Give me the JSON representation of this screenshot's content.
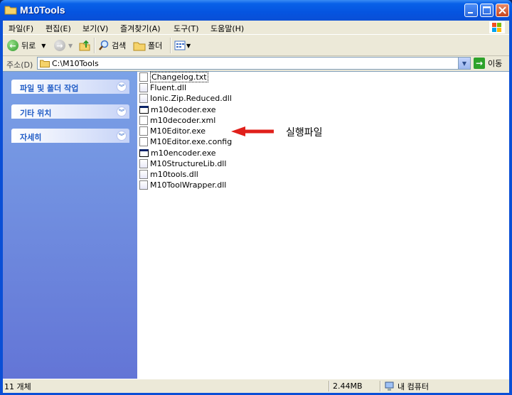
{
  "window": {
    "title": "M10Tools"
  },
  "menu": [
    "파일(F)",
    "편집(E)",
    "보기(V)",
    "즐겨찾기(A)",
    "도구(T)",
    "도움말(H)"
  ],
  "toolbar": {
    "back": "뒤로",
    "search": "검색",
    "folders": "폴더"
  },
  "address": {
    "label": "주소(D)",
    "path": "C:\\M10Tools",
    "go": "이동"
  },
  "taskpane": {
    "sections": [
      "파일 및 폴더 작업",
      "기타 위치",
      "자세히"
    ]
  },
  "files": [
    {
      "name": "Changelog.txt",
      "type": "txt"
    },
    {
      "name": "Fluent.dll",
      "type": "dll"
    },
    {
      "name": "Ionic.Zip.Reduced.dll",
      "type": "dll"
    },
    {
      "name": "m10decoder.exe",
      "type": "exe"
    },
    {
      "name": "m10decoder.xml",
      "type": "xml"
    },
    {
      "name": "M10Editor.exe",
      "type": "exe2"
    },
    {
      "name": "M10Editor.exe.config",
      "type": "xml"
    },
    {
      "name": "m10encoder.exe",
      "type": "exe"
    },
    {
      "name": "M10StructureLib.dll",
      "type": "dll"
    },
    {
      "name": "m10tools.dll",
      "type": "dll"
    },
    {
      "name": "M10ToolWrapper.dll",
      "type": "dll"
    }
  ],
  "annotation": {
    "text": "실행파일",
    "color": "#e0201b"
  },
  "status": {
    "count": "11 개체",
    "size": "2.44MB",
    "location": "내 컴퓨터"
  }
}
